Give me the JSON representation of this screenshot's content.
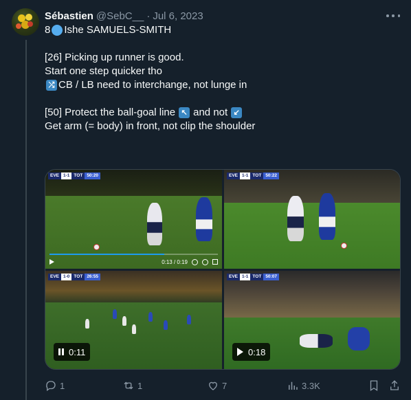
{
  "author": {
    "name": "Sébastien",
    "handle": "@SebC__",
    "separator": "·",
    "date": "Jul 6, 2023"
  },
  "tweet": {
    "line1_prefix": "8",
    "line1_name": "Ishe SAMUELS-SMITH",
    "line2": "[26] Picking up runner is good.",
    "line3": "Start one step quicker tho",
    "line4": "CB / LB need to interchange, not lunge in",
    "line5_a": "[50] Protect the ball-goal line",
    "line5_b": "and not",
    "line6": "Get arm (= body) in front, not clip the shoulder",
    "emoji_shuffle": "⤮",
    "emoji_arrow_upleft": "↖",
    "emoji_arrow_downleft": "↙"
  },
  "media": {
    "tiles": [
      {
        "team1": "EVE",
        "score": "1-1",
        "team2": "TOT",
        "clock": "50:20",
        "time_display": "0:13 / 0:19",
        "progress": 0.68
      },
      {
        "team1": "EVE",
        "score": "1-1",
        "team2": "TOT",
        "clock": "50:22"
      },
      {
        "team1": "EVE",
        "score": "1-0",
        "team2": "TOT",
        "clock": "26:55",
        "duration": "0:11",
        "state": "paused"
      },
      {
        "team1": "EVE",
        "score": "1-1",
        "team2": "TOT",
        "clock": "50:07",
        "duration": "0:18",
        "state": "play"
      }
    ]
  },
  "actions": {
    "replies": "1",
    "reposts": "1",
    "likes": "7",
    "views": "3.3K"
  },
  "colors": {
    "background": "#15202b",
    "text_primary": "#f7f9f9",
    "text_secondary": "#8b98a5",
    "accent": "#1d9bf0"
  },
  "icons": [
    "more-icon",
    "reply-icon",
    "repost-icon",
    "like-icon",
    "views-icon",
    "bookmark-icon",
    "share-icon"
  ]
}
